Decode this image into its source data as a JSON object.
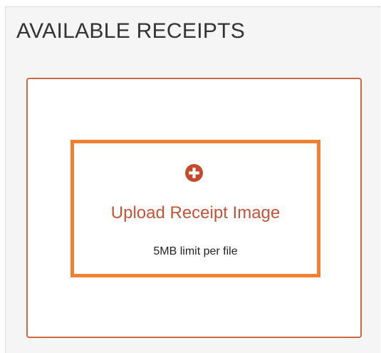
{
  "section": {
    "title": "AVAILABLE RECEIPTS"
  },
  "upload": {
    "icon": "plus-circle-icon",
    "label": "Upload Receipt Image",
    "limit_text": "5MB limit per file"
  },
  "colors": {
    "accent_orange": "#ee8131",
    "brand_red": "#c0553a",
    "dropzone_border": "#c96a45",
    "icon_fill": "#c54a2d"
  }
}
